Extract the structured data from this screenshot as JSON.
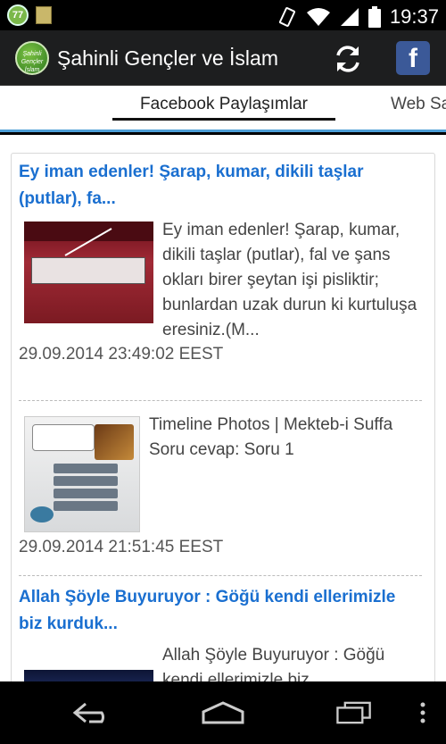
{
  "status_bar": {
    "notification_badge": "77",
    "time": "19:37"
  },
  "app": {
    "logo_text": "Şahinli Gençler İslam",
    "title": "Şahinli Gençler ve İslam"
  },
  "tabs": {
    "active": "Facebook Paylaşımlar",
    "next": "Web Sa"
  },
  "posts": [
    {
      "title": "Ey iman edenler! Şarap, kumar, dikili taşlar (putlar), fa...",
      "body": "Ey iman edenler! Şarap, kumar, dikili taşlar (putlar), fal ve şans okları birer şeytan işi pisliktir; bunlardan uzak durun ki kurtuluşa eresiniz.(M...",
      "date": "29.09.2014 23:49:02 EEST",
      "thumb_icon": "maide-90-image"
    },
    {
      "title": "",
      "body": "Timeline Photos | Mekteb-i Suffa Soru cevap: Soru 1",
      "date": "29.09.2014 21:51:45 EEST",
      "thumb_icon": "quran-quiz-image"
    },
    {
      "title": "Allah Şöyle Buyuruyor : Göğü kendi ellerimizle biz kurduk...",
      "body": "Allah Şöyle Buyuruyor : Göğü kendi ellerimizle biz",
      "date": "",
      "thumb_icon": "night-sky-image"
    }
  ],
  "colors": {
    "action_bar": "#1d1e1f",
    "tab_indicator": "#4d9fd7",
    "post_title": "#1a6fd0",
    "facebook": "#3b5998"
  }
}
